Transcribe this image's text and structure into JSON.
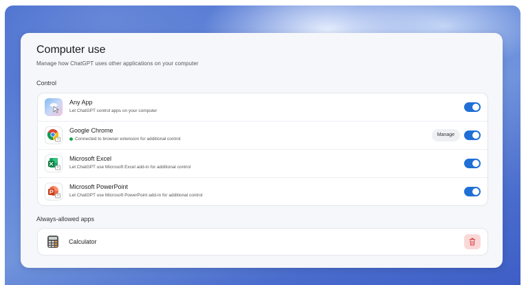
{
  "panel": {
    "title": "Computer use",
    "subtitle": "Manage how ChatGPT uses other applications on your computer"
  },
  "sections": {
    "control_label": "Control",
    "always_allowed_label": "Always-allowed apps"
  },
  "apps": [
    {
      "name": "Any App",
      "description": "Let ChatGPT control apps on your computer",
      "enabled": true,
      "icon": "any-app-icon"
    },
    {
      "name": "Google Chrome",
      "description": "Connected to browser extension for additional control",
      "status": "connected",
      "manage_label": "Manage",
      "enabled": true,
      "icon": "chrome-icon"
    },
    {
      "name": "Microsoft Excel",
      "description": "Let ChatGPT use Microsoft Excel add-in for additional control",
      "enabled": true,
      "icon": "excel-icon"
    },
    {
      "name": "Microsoft PowerPoint",
      "description": "Let ChatGPT use Microsoft PowerPoint add-in for additional control",
      "enabled": true,
      "icon": "powerpoint-icon"
    }
  ],
  "always_allowed": [
    {
      "name": "Calculator",
      "icon": "calculator-icon",
      "action_icon": "trash-icon"
    }
  ],
  "colors": {
    "toggle_on": "#1f6fd6",
    "status_connected": "#19a34a",
    "delete_bg": "#fbd8d8",
    "delete_icon": "#d64545"
  }
}
